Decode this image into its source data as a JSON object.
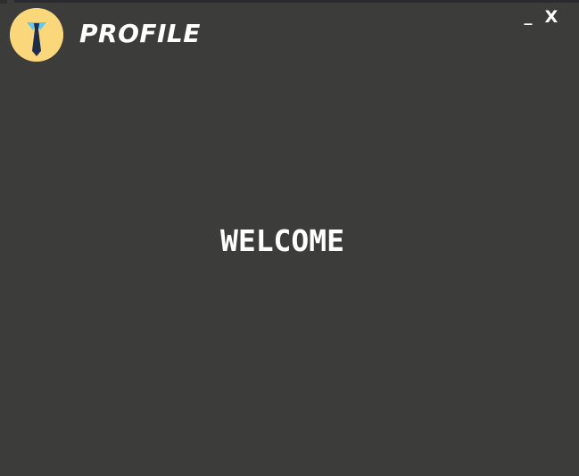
{
  "window": {
    "title": "PROFILE",
    "minimize_label": "_",
    "close_label": "X"
  },
  "avatar": {
    "icon": "tie-avatar-icon"
  },
  "main": {
    "welcome_text": "WELCOME"
  },
  "colors": {
    "background": "#3c3d3b",
    "avatar_bg": "#fbd77b",
    "text": "#ffffff",
    "tie": "#1f2c4a",
    "collar": "#5fc9ef"
  }
}
